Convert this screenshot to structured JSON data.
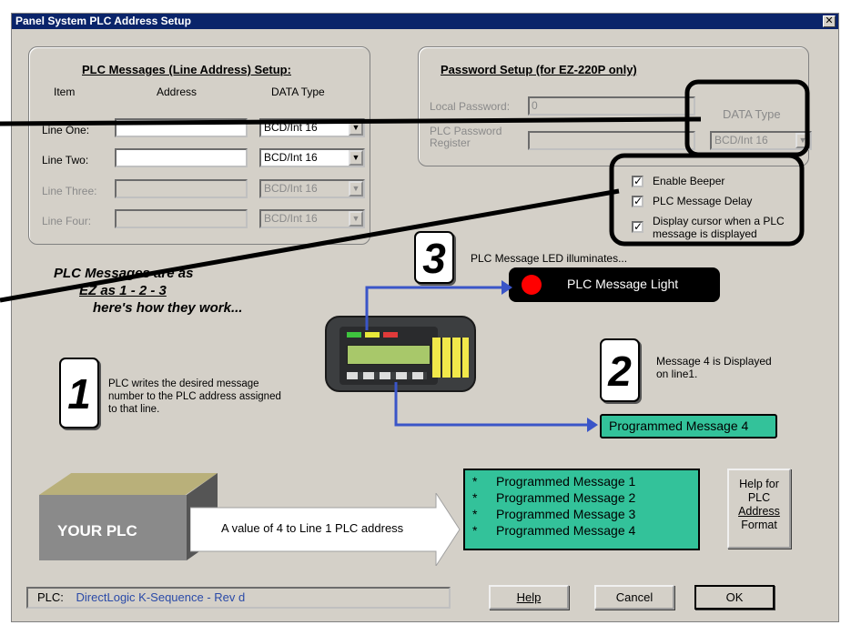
{
  "window": {
    "title": "Panel System PLC Address Setup",
    "close_glyph": "✕"
  },
  "plc_messages": {
    "title": "PLC Messages (Line Address) Setup:",
    "col_item": "Item",
    "col_address": "Address",
    "col_datatype": "DATA Type",
    "lines": [
      {
        "label": "Line One:",
        "address": "",
        "datatype": "BCD/Int 16",
        "enabled": true
      },
      {
        "label": "Line Two:",
        "address": "",
        "datatype": "BCD/Int 16",
        "enabled": true
      },
      {
        "label": "Line Three:",
        "address": "",
        "datatype": "BCD/Int 16",
        "enabled": false
      },
      {
        "label": "Line Four:",
        "address": "",
        "datatype": "BCD/Int 16",
        "enabled": false
      }
    ]
  },
  "password": {
    "title": "Password Setup (for EZ-220P only)",
    "local_label": "Local Password:",
    "local_value": "0",
    "register_label_1": "PLC Password",
    "register_label_2": "Register",
    "datatype_label": "DATA Type",
    "datatype_value": "BCD/Int 16"
  },
  "options": {
    "enable_beeper": "Enable Beeper",
    "plc_message_delay": "PLC Message Delay",
    "display_cursor_1": "Display cursor when a PLC",
    "display_cursor_2": "message is displayed"
  },
  "howto": {
    "line1": "PLC Messages are as",
    "line2": "EZ as 1 - 2 - 3",
    "line3": "here's how they work...",
    "step1_num": "1",
    "step1_text": "PLC writes the desired message number to the PLC address assigned to that line.",
    "step2_num": "2",
    "step2_text": "Message 4 is Displayed on line1.",
    "step3_num": "3",
    "step3_text": "PLC Message LED illuminates...",
    "led_label": "PLC Message Light",
    "programmed_msg4": "Programmed Message 4",
    "your_plc": "YOUR PLC",
    "value_text": "A value of 4 to Line 1 PLC address",
    "messages": [
      {
        "bullet": "*",
        "text": "Programmed Message 1"
      },
      {
        "bullet": "*",
        "text": "Programmed Message 2"
      },
      {
        "bullet": "*",
        "text": "Programmed Message 3"
      },
      {
        "bullet": "*",
        "text": "Programmed Message 4"
      }
    ]
  },
  "help_format_button": {
    "l1": "Help for",
    "l2": "PLC",
    "l3": "Address",
    "l4": "Format"
  },
  "status": {
    "plc_label": "PLC:",
    "plc_value": "DirectLogic  K-Sequence - Rev d"
  },
  "buttons": {
    "help": "Help",
    "cancel": "Cancel",
    "ok": "OK"
  },
  "colors": {
    "titlebar": "#0a246a",
    "green_box": "#33c29a",
    "blue_arrow": "#3a55c8",
    "led_red": "#ff0000"
  }
}
